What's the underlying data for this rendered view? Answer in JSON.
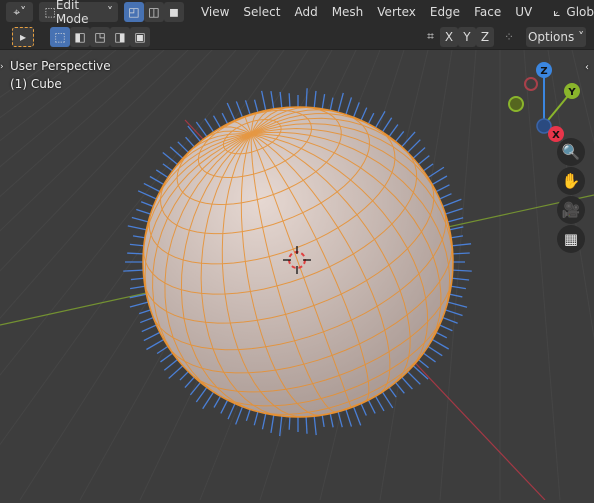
{
  "header": {
    "mode": "Edit Mode",
    "menus": [
      "View",
      "Select",
      "Add",
      "Mesh",
      "Vertex",
      "Edge",
      "Face",
      "UV"
    ],
    "orientation": "Glob"
  },
  "toolbar": {
    "axes": [
      "X",
      "Y",
      "Z"
    ],
    "options": "Options"
  },
  "viewport": {
    "view_name": "User Perspective",
    "object": "(1) Cube"
  },
  "gizmo": {
    "z": "Z",
    "y": "Y",
    "x": "X"
  },
  "colors": {
    "accent": "#4772b3",
    "edge": "#e8902f",
    "normal": "#4a7fd6",
    "x_axis": "#e8354a",
    "y_axis": "#8ab52c",
    "z_axis": "#3b86e0"
  }
}
